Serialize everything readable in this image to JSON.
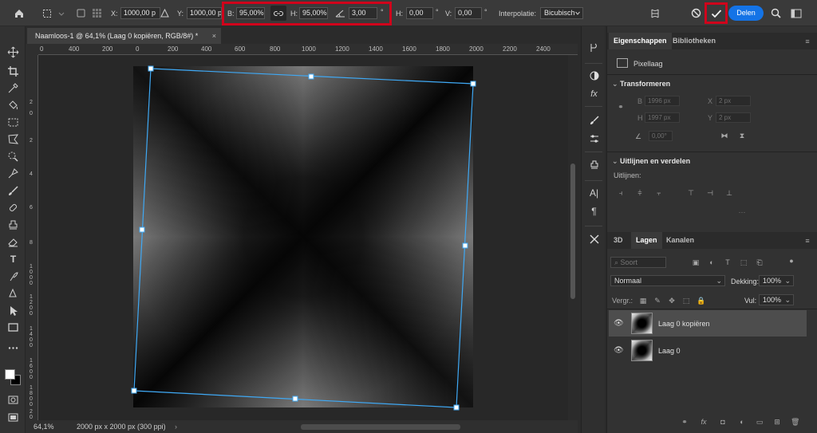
{
  "options_bar": {
    "x_label": "X:",
    "x_value": "1000,00 p",
    "y_label": "Y:",
    "y_value": "1000,00 p",
    "w_label": "B:",
    "w_value": "95,00%",
    "h_label": "H:",
    "h_value": "95,00%",
    "angle_value": "3,00",
    "angle_unit": "°",
    "skew_h_label": "H:",
    "skew_h_value": "0,00",
    "skew_v_label": "V:",
    "skew_v_value": "0,00",
    "skew_unit": "°",
    "interpolation_label": "Interpolatie:",
    "interpolation_value": "Bicubisch",
    "share_label": "Delen",
    "highlight_color": "#d0021b",
    "accent_color": "#1473e6"
  },
  "document": {
    "tab_title": "Naamloos-1 @ 64,1% (Laag 0 kopiëren, RGB/8#) *",
    "close_glyph": "×"
  },
  "ruler": {
    "h_ticks": [
      "0",
      "400",
      "200",
      "0",
      "200",
      "400",
      "600",
      "800",
      "1000",
      "1200",
      "1400",
      "1600",
      "1800",
      "2000",
      "2200",
      "2400"
    ],
    "v_ticks": [
      "2",
      "0",
      "2",
      "4",
      "6",
      "8",
      "1000",
      "1200",
      "1400",
      "1600",
      "1800",
      "200"
    ]
  },
  "status": {
    "zoom": "64,1%",
    "doc_size": "2000 px x 2000 px (300 ppi)",
    "arrow": "›"
  },
  "properties_panel": {
    "tabs": [
      "Eigenschappen",
      "Bibliotheken"
    ],
    "layer_kind": "Pixellaag",
    "transform_heading": "Transformeren",
    "w_label": "B",
    "w_value": "1996 px",
    "x_label": "X",
    "x_value": "2 px",
    "h_label": "H",
    "h_value": "1997 px",
    "y_label": "Y",
    "y_value": "2 px",
    "angle_value": "0,00°",
    "align_heading": "Uitlijnen en verdelen",
    "align_label": "Uitlijnen:"
  },
  "layers_panel": {
    "tabs": [
      "3D",
      "Lagen",
      "Kanalen"
    ],
    "filter_label": "Soort",
    "blend_mode": "Normaal",
    "opacity_label": "Dekking:",
    "opacity_value": "100%",
    "lock_label": "Vergr.:",
    "fill_label": "Vul:",
    "fill_value": "100%",
    "layers": [
      {
        "name": "Laag 0 kopiëren",
        "selected": true
      },
      {
        "name": "Laag 0",
        "selected": false
      }
    ]
  }
}
